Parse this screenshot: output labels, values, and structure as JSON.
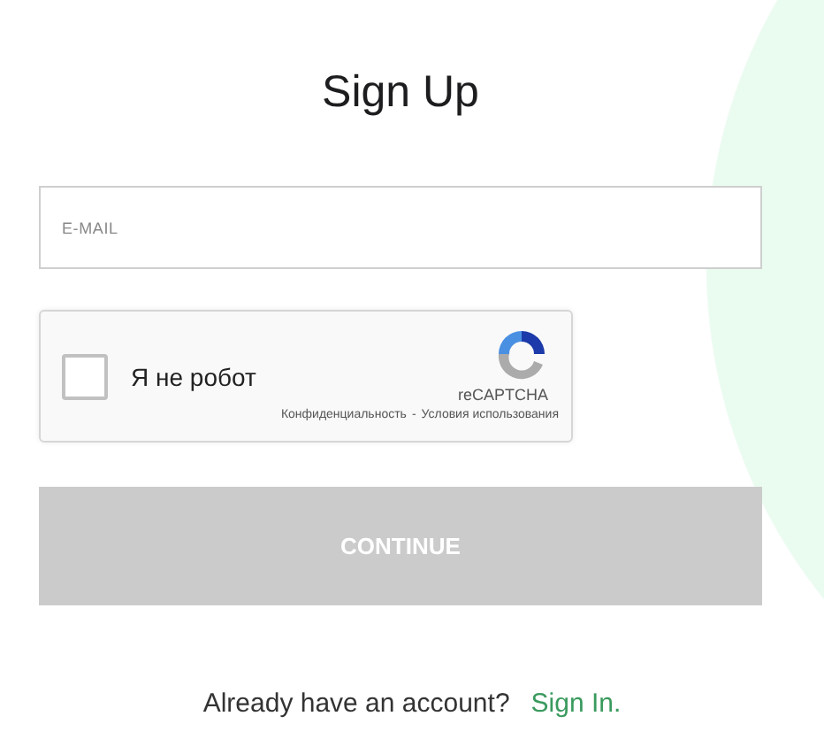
{
  "title": "Sign Up",
  "email": {
    "placeholder": "E-MAIL"
  },
  "captcha": {
    "label": "Я не робот",
    "checked": false,
    "brand": "reCAPTCHA",
    "privacy": "Конфиденциальность",
    "separator": "-",
    "terms": "Условия использования"
  },
  "continue_button": {
    "label": "CONTINUE",
    "disabled": true
  },
  "footer": {
    "text": "Already have an account?",
    "link": "Sign In."
  }
}
